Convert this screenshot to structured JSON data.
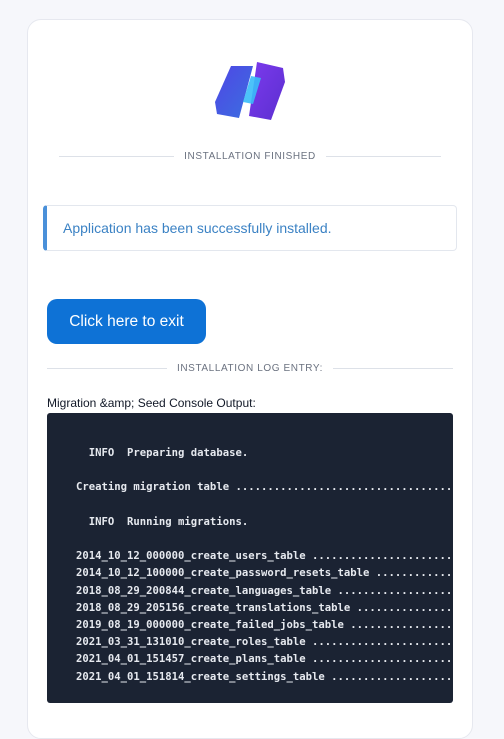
{
  "heading": "INSTALLATION FINISHED",
  "alert": {
    "message": "Application has been successfully installed."
  },
  "exit_button": {
    "label": "Click here to exit"
  },
  "log_heading": "INSTALLATION LOG ENTRY:",
  "output_label": "Migration &amp; Seed Console Output:",
  "console_output": "  INFO  Preparing database.\n\nCreating migration table .......................................\n\n  INFO  Running migrations.\n\n2014_10_12_000000_create_users_table ...........................\n2014_10_12_100000_create_password_resets_table .................\n2018_08_29_200844_create_languages_table .......................\n2018_08_29_205156_create_translations_table ....................\n2019_08_19_000000_create_failed_jobs_table .....................\n2021_03_31_131010_create_roles_table ...........................\n2021_04_01_151457_create_plans_table ...........................\n2021_04_01_151814_create_settings_table ........................",
  "colors": {
    "brand": "#0e72d6",
    "alert_accent": "#4a90d9",
    "alert_text": "#3b82c4",
    "console_bg": "#1b2333",
    "logo_dark": "#3b4fd8",
    "logo_light": "#5b2fd0"
  }
}
